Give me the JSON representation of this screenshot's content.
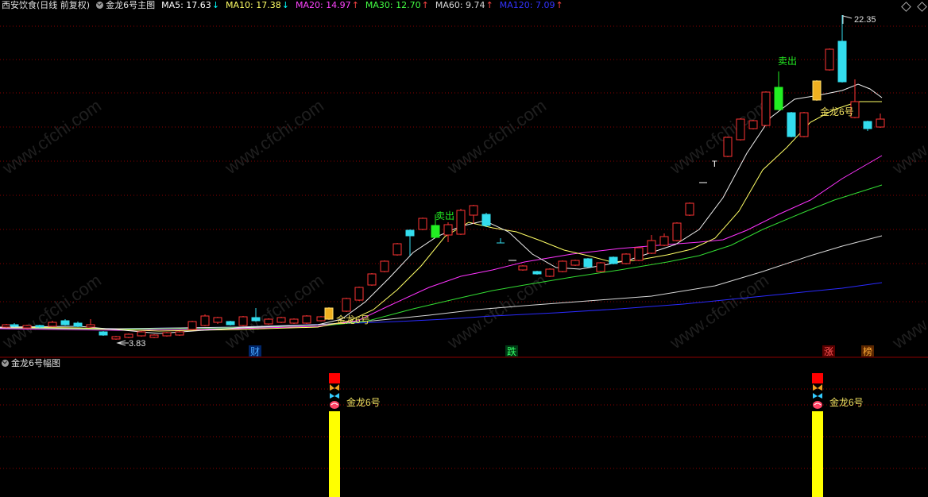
{
  "header": {
    "title": "西安饮食(日线 前复权)",
    "indicator_name": "金龙6号主图",
    "ma": [
      {
        "label": "MA5: 17.63",
        "arrow": "↓",
        "color": "#ffffff",
        "arrow_color": "#00ffff"
      },
      {
        "label": "MA10: 17.38",
        "arrow": "↓",
        "color": "#ffff66",
        "arrow_color": "#00ffff"
      },
      {
        "label": "MA20: 14.97",
        "arrow": "↑",
        "color": "#ff44ff",
        "arrow_color": "#ff4444"
      },
      {
        "label": "MA30: 12.70",
        "arrow": "↑",
        "color": "#44ff44",
        "arrow_color": "#ff4444"
      },
      {
        "label": "MA60: 9.74",
        "arrow": "↑",
        "color": "#d8d8d8",
        "arrow_color": "#ff4444"
      },
      {
        "label": "MA120: 7.09",
        "arrow": "↑",
        "color": "#3333ff",
        "arrow_color": "#ff4444"
      }
    ]
  },
  "subchart": {
    "title": "金龙6号幅图"
  },
  "annotations": {
    "high_price": "22.35",
    "low_price": "3.83",
    "signal_label": "金龙6号",
    "sell_label": "卖出",
    "event_cai": "财",
    "event_die": "跌",
    "event_zhang": "涨",
    "event_bang": "榜",
    "watermark": "www.cfchi.com"
  },
  "colors": {
    "background": "#000000",
    "grid": "#8a0000",
    "up_candle": "#ff3333",
    "down_candle": "#33ddee",
    "signal_bar": "#ffff00",
    "signal_top": "#ff0000",
    "sell_candle": "#22ee22"
  }
}
